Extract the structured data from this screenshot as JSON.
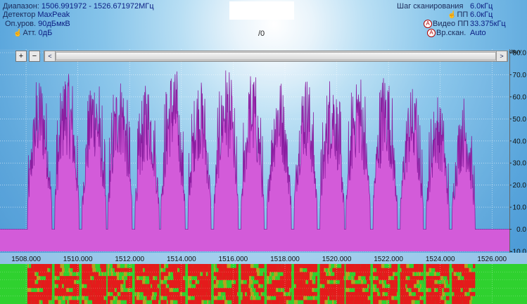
{
  "header": {
    "range_label": "Диапазон:",
    "range_value": "1506.991972 - 1526.671972МГц",
    "detector_label": "Детектор",
    "detector_value": "MaxPeak",
    "ref_label": "Оп.уров.",
    "ref_value": "90дБмкВ",
    "att_label": "Атт.",
    "att_value": "0дБ",
    "step_label": "Шаг сканирования",
    "step_value": "6.0кГц",
    "rbw_label": "ПП",
    "rbw_value": "6.0кГц",
    "vbw_label": "Видео ПП",
    "vbw_value": "33.375кГц",
    "sweep_label": "Вр.скан.",
    "sweep_value": "Auto",
    "center_text": "/0",
    "auto_badge": "A"
  },
  "toolbar": {
    "zoom_in": "+",
    "zoom_out": "−",
    "scroll_left": "<",
    "scroll_right": ">"
  },
  "colors": {
    "trace": "#d35bd9",
    "trace_line": "#8a1ea0",
    "waterfall_bg": "#2fd12f",
    "waterfall_signal": "#e41b1b",
    "grid": "#ffffff"
  },
  "chart_data": {
    "type": "area",
    "ylabel": "dBµV",
    "ylim": [
      -10,
      80
    ],
    "yticks": [
      "80.0",
      "70.0",
      "60.0",
      "50.0",
      "40.0",
      "30.0",
      "20.0",
      "10.0",
      "0.0",
      "-10.0"
    ],
    "xlim": [
      1506.991972,
      1526.671972
    ],
    "xticks": [
      "1508.000",
      "1510.000",
      "1512.000",
      "1514.000",
      "1516.000",
      "1518.000",
      "1520.000",
      "1522.000",
      "1524.000",
      "1526.000"
    ],
    "baseline": 0,
    "bursts": [
      {
        "start": 1508.05,
        "end": 1509.0,
        "peak": 70
      },
      {
        "start": 1509.1,
        "end": 1510.05,
        "peak": 74
      },
      {
        "start": 1510.15,
        "end": 1511.1,
        "peak": 71
      },
      {
        "start": 1511.15,
        "end": 1512.1,
        "peak": 72
      },
      {
        "start": 1512.2,
        "end": 1513.15,
        "peak": 67
      },
      {
        "start": 1513.2,
        "end": 1514.15,
        "peak": 75
      },
      {
        "start": 1514.25,
        "end": 1515.15,
        "peak": 70
      },
      {
        "start": 1515.25,
        "end": 1516.2,
        "peak": 74
      },
      {
        "start": 1516.3,
        "end": 1517.2,
        "peak": 72
      },
      {
        "start": 1517.3,
        "end": 1518.25,
        "peak": 70
      },
      {
        "start": 1518.35,
        "end": 1519.25,
        "peak": 72
      },
      {
        "start": 1519.35,
        "end": 1520.3,
        "peak": 71
      },
      {
        "start": 1520.35,
        "end": 1521.3,
        "peak": 72
      },
      {
        "start": 1521.4,
        "end": 1522.35,
        "peak": 72
      },
      {
        "start": 1522.45,
        "end": 1523.35,
        "peak": 65
      },
      {
        "start": 1523.45,
        "end": 1524.35,
        "peak": 61
      },
      {
        "start": 1524.45,
        "end": 1525.35,
        "peak": 60
      }
    ]
  }
}
